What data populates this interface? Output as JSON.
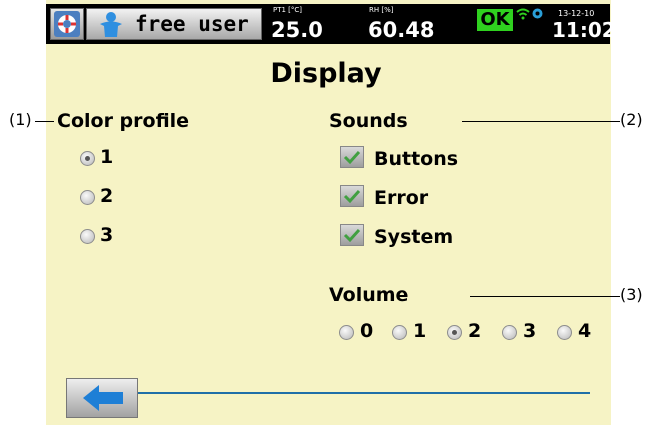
{
  "statusbar": {
    "user_label": "free user",
    "sensor1": {
      "label": "PT1 [°C]",
      "value": "25.0"
    },
    "sensor2": {
      "label": "RH [%]",
      "value": "60.48"
    },
    "status": "OK",
    "date": "13-12-10",
    "time": "11:02"
  },
  "page_title": "Display",
  "color_profile": {
    "heading": "Color profile",
    "options": [
      "1",
      "2",
      "3"
    ],
    "selected": "1"
  },
  "sounds": {
    "heading": "Sounds",
    "items": [
      {
        "label": "Buttons",
        "checked": true
      },
      {
        "label": "Error",
        "checked": true
      },
      {
        "label": "System",
        "checked": true
      }
    ]
  },
  "volume": {
    "heading": "Volume",
    "options": [
      "0",
      "1",
      "2",
      "3",
      "4"
    ],
    "selected": "2"
  },
  "annotations": {
    "a1": "(1)",
    "a2": "(2)",
    "a3": "(3)"
  },
  "icons": {
    "help": "lifebuoy-icon",
    "user": "user-icon",
    "wifi": "wifi-icon",
    "network": "network-icon",
    "back": "back-arrow-icon"
  },
  "colors": {
    "screen_bg": "#f6f3c5",
    "status_ok": "#2fd11f",
    "back_arrow": "#1e7fd6",
    "bottom_line": "#1f6fa8"
  }
}
